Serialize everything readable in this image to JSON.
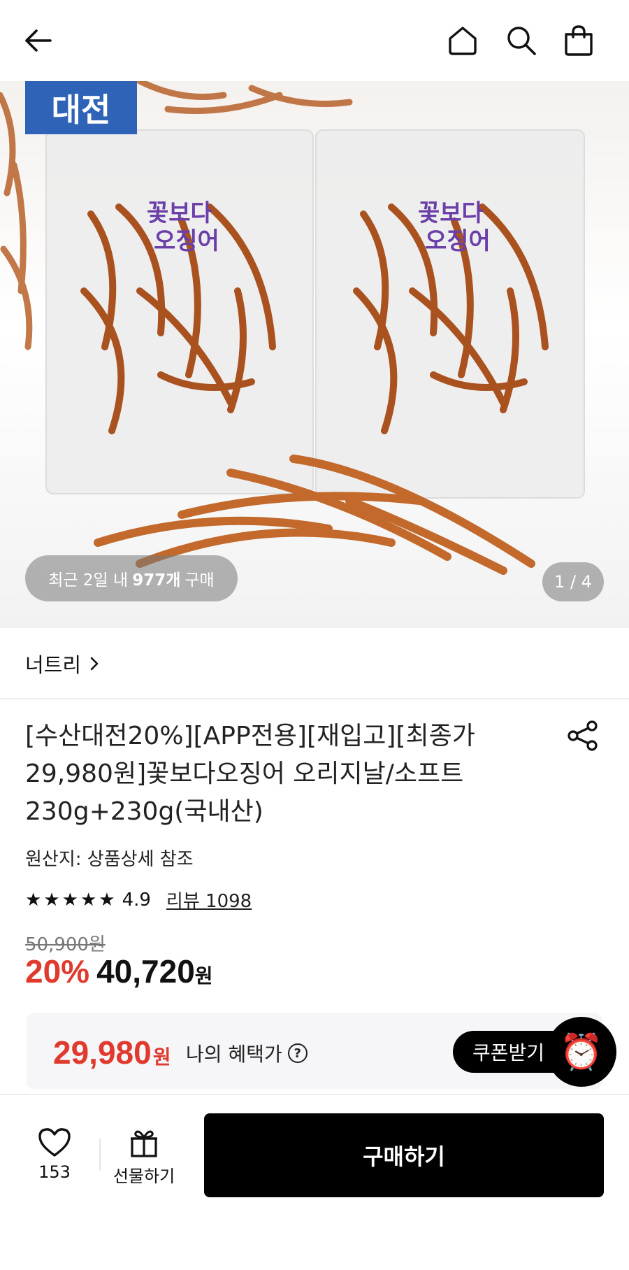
{
  "header": {
    "back_icon": "arrow-left-icon",
    "home_icon": "home-icon",
    "search_icon": "search-icon",
    "cart_icon": "shopping-bag-icon"
  },
  "gallery": {
    "badge_text": "대전",
    "recent_prefix": "최근 2일 내",
    "recent_count": "977개",
    "recent_suffix": "구매",
    "page_indicator": "1 / 4",
    "current_page": 1,
    "total_pages": 4
  },
  "brand": {
    "name": "너트리",
    "chevron": "›"
  },
  "product": {
    "title": "[수산대전20%][APP전용][재입고][최종가 29,980원]꽃보다오징어 오리지날/소프트 230g+230g(국내산)",
    "origin": "원산지: 상품상세 참조",
    "rating": "4.9",
    "rating_stars": 5,
    "review_label": "리뷰 1098",
    "original_price": "50,900원",
    "discount_rate": "20%",
    "sale_price": "40,720",
    "price_unit": "원"
  },
  "benefit": {
    "price": "29,980",
    "unit": "원",
    "label": "나의 혜택가",
    "help": "?",
    "coupon_button": "쿠폰받기",
    "alarm_icon": "⏰"
  },
  "bottom_bar": {
    "like_count": "153",
    "gift_label": "선물하기",
    "buy_label": "구매하기"
  },
  "colors": {
    "accent_red": "#e03a2f",
    "badge_blue": "#2f63b8",
    "button_black": "#000000"
  }
}
